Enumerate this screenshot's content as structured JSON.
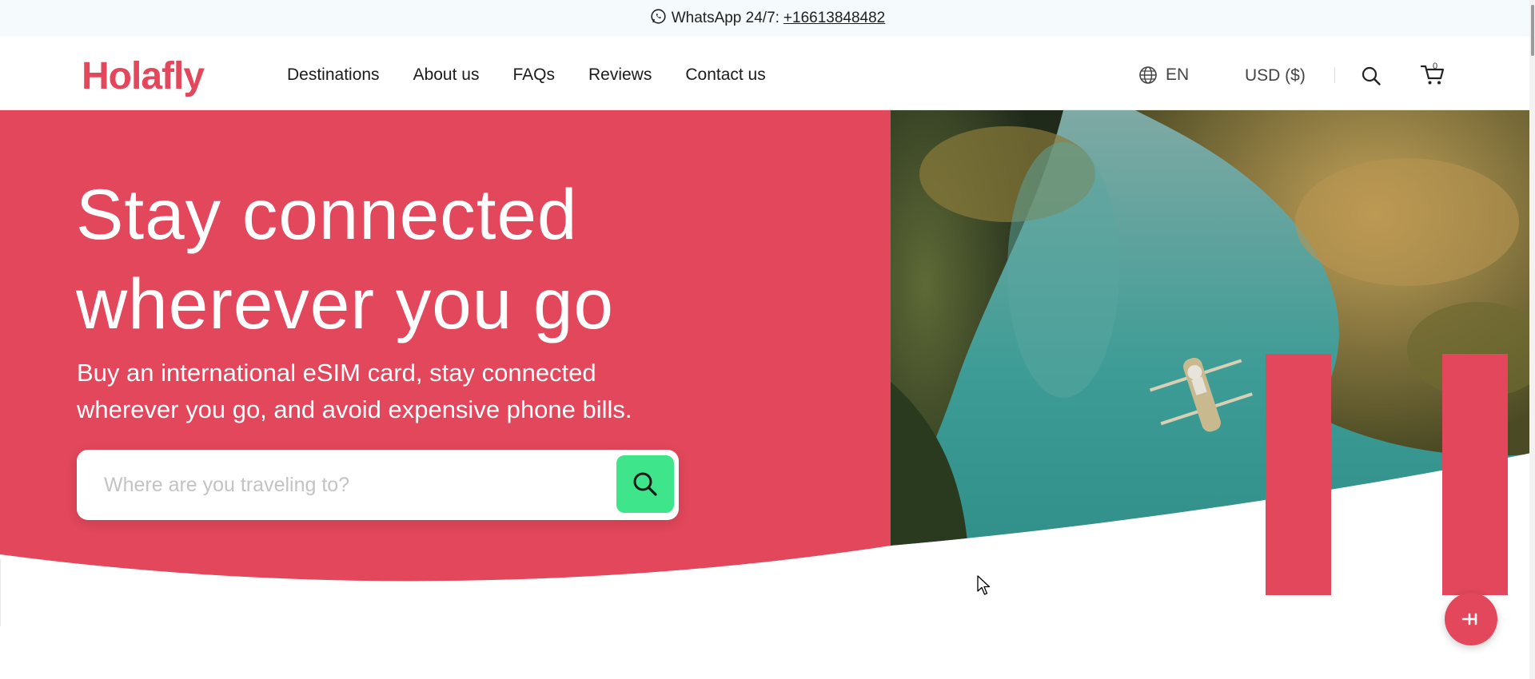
{
  "topbar": {
    "label": "WhatsApp 24/7:",
    "phone": "+16613848482",
    "icon": "whatsapp-icon"
  },
  "header": {
    "logo": "Holafly",
    "nav": [
      {
        "label": "Destinations"
      },
      {
        "label": "About us"
      },
      {
        "label": "FAQs"
      },
      {
        "label": "Reviews"
      },
      {
        "label": "Contact us"
      }
    ],
    "language": "EN",
    "currency": "USD ($)",
    "cart_count": "0"
  },
  "hero": {
    "title": "Stay connected wherever you go",
    "subtitle": "Buy an international eSIM card, stay connected wherever you go, and avoid expensive phone bills.",
    "search_placeholder": "Where are you traveling to?"
  },
  "colors": {
    "brand": "#e2475b",
    "search_button": "#3ee58b",
    "topbar_bg": "#f5fafd"
  }
}
